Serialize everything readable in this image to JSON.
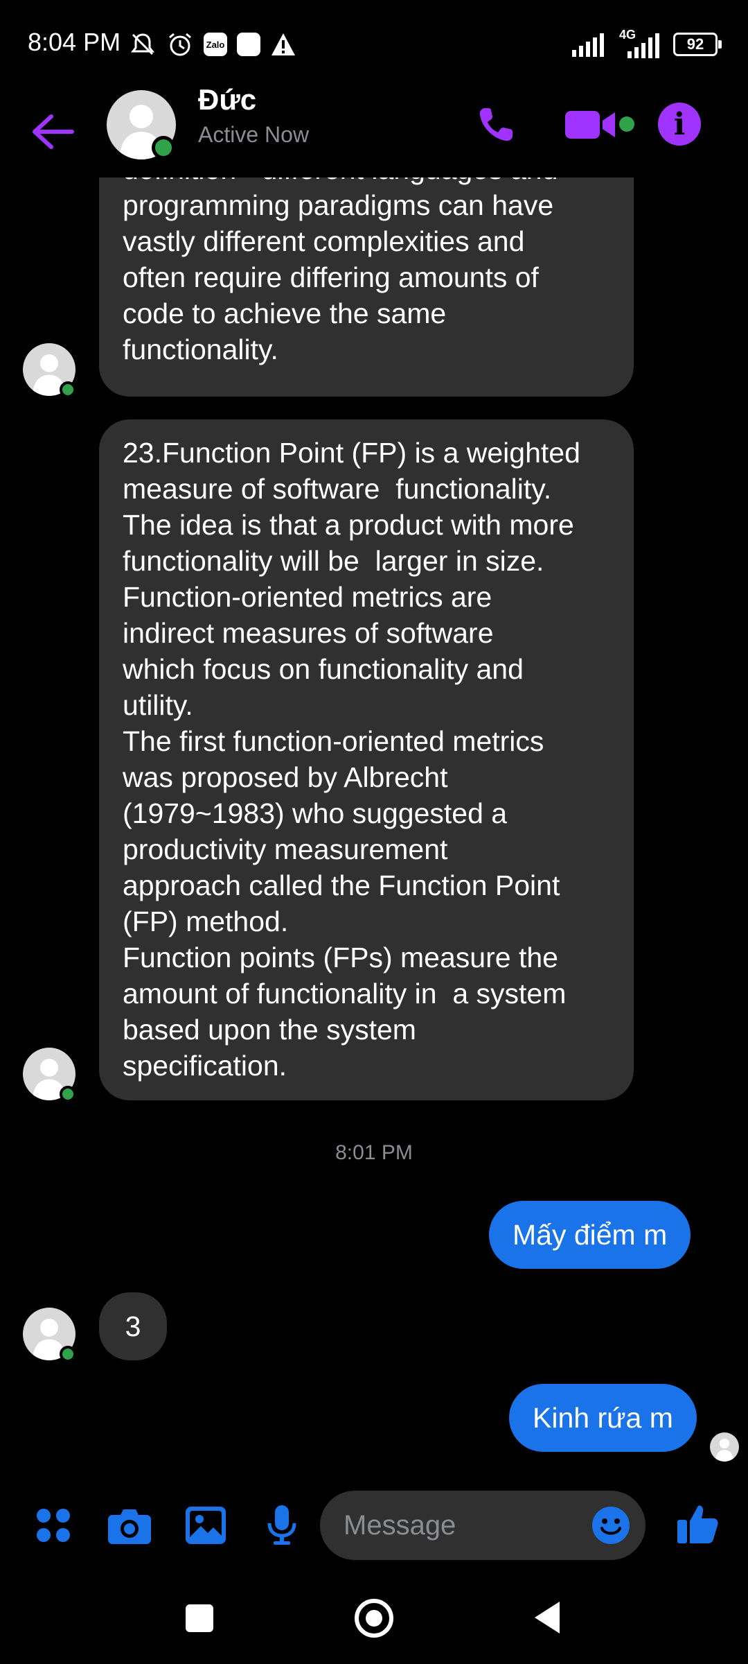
{
  "status_bar": {
    "time": "8:04 PM",
    "left_icons": [
      "mute-icon",
      "alarm-icon",
      "zalo-icon",
      "notification-icon",
      "warning-icon"
    ],
    "zalo_label": "Zalo",
    "network": "4G",
    "battery": "92"
  },
  "header": {
    "contact_name": "Đức",
    "presence": "Active Now",
    "icons": [
      "back-arrow-icon",
      "phone-icon",
      "video-call-icon",
      "info-icon"
    ],
    "accent_color": "#a033ff",
    "online_color": "#31a24c"
  },
  "messages": [
    {
      "direction": "incoming",
      "text": "definition - different languages and\nprogramming paradigms can have\nvastly different complexities and\noften require differing amounts of\ncode to achieve the same\nfunctionality."
    },
    {
      "direction": "incoming",
      "text": "23.Function Point (FP) is a weighted\nmeasure of software  functionality.\nThe idea is that a product with more\nfunctionality will be  larger in size.\nFunction-oriented metrics are\nindirect measures of software\nwhich focus on functionality and\nutility.\nThe first function-oriented metrics\nwas proposed by Albrecht\n(1979~1983) who suggested a\nproductivity measurement\napproach called the Function Point\n(FP) method.\nFunction points (FPs) measure the\namount of functionality in  a system\nbased upon the system\nspecification."
    },
    {
      "direction": "timestamp",
      "text": "8:01 PM"
    },
    {
      "direction": "outgoing",
      "text": "Mấy điểm m"
    },
    {
      "direction": "incoming",
      "text": "3"
    },
    {
      "direction": "outgoing",
      "text": "Kinh rứa m"
    }
  ],
  "composer": {
    "placeholder": "Message",
    "icons": [
      "menu-grid-icon",
      "camera-icon",
      "gallery-icon",
      "microphone-icon",
      "emoji-icon",
      "like-icon"
    ],
    "icon_color": "#1a73e8"
  },
  "nav_bar": {
    "icons": [
      "recents-icon",
      "home-icon",
      "back-icon"
    ]
  }
}
